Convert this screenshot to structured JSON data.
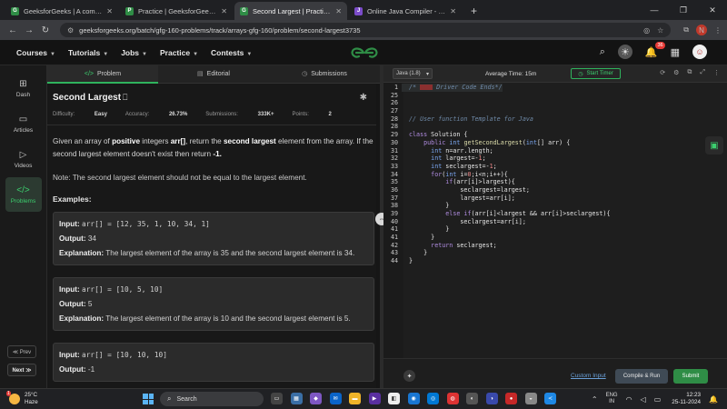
{
  "browser": {
    "tabs": [
      {
        "title": "GeeksforGeeks | A computer sc",
        "fav": "G",
        "color": "#2f8d46",
        "active": false
      },
      {
        "title": "Practice | GeeksforGeeks | A co",
        "fav": "P",
        "color": "#2f8d46",
        "active": false
      },
      {
        "title": "Second Largest | Practice | Gee",
        "fav": "G",
        "color": "#2f8d46",
        "active": true
      },
      {
        "title": "Online Java Compiler - Progra",
        "fav": "J",
        "color": "#7b4cc9",
        "active": false
      }
    ],
    "url": "geeksforgeeks.org/batch/gfg-160-problems/track/arrays-gfg-160/problem/second-largest3735",
    "profile_initial": "N"
  },
  "site": {
    "menu": [
      "Courses",
      "Tutorials",
      "Jobs",
      "Practice",
      "Contests"
    ],
    "logo_color": "#2f8d46",
    "notif_count": "36"
  },
  "rail": {
    "items": [
      {
        "label": "Dash",
        "icon": "⊞"
      },
      {
        "label": "Articles",
        "icon": "▭"
      },
      {
        "label": "Videos",
        "icon": "▷"
      },
      {
        "label": "Problems",
        "icon": "</>"
      }
    ],
    "prev": "≪ Prev",
    "next": "Next ≫"
  },
  "problem_tabs": {
    "problem": "Problem",
    "editorial": "Editorial",
    "submissions": "Submissions"
  },
  "problem": {
    "title": "Second Largest",
    "difficulty_label": "Difficulty:",
    "difficulty": "Easy",
    "accuracy_label": "Accuracy:",
    "accuracy": "26.73%",
    "submissions_label": "Submissions:",
    "submissions": "333K+",
    "points_label": "Points:",
    "points": "2",
    "desc_1": "Given an array of ",
    "desc_b1": "positive",
    "desc_2": " integers ",
    "desc_b2": "arr[]",
    "desc_3": ", return the ",
    "desc_b3": "second largest",
    "desc_4": " element from the array. If the second largest element doesn't exist then return ",
    "desc_b4": "-1.",
    "note": "Note: The second largest element should not be equal to the largest element.",
    "examples_heading": "Examples:",
    "input_label": "Input:",
    "output_label": "Output:",
    "explanation_label": "Explanation:",
    "examples": [
      {
        "input": "arr[] = [12, 35, 1, 10, 34, 1]",
        "output": "34",
        "explanation": "The largest element of the array is 35 and the second largest element is 34."
      },
      {
        "input": "arr[] = [10, 5, 10]",
        "output": "5",
        "explanation": "The largest element of the array is 10 and the second largest element is 5."
      },
      {
        "input": "arr[] = [10, 10, 10]",
        "output": "-1"
      }
    ]
  },
  "editor": {
    "language": "Java (1.8)",
    "avg_time": "Average Time: 15m",
    "start_timer": "Start Timer",
    "custom_input": "Custom Input",
    "compile_run": "Compile & Run",
    "submit": "Submit",
    "lines": [
      {
        "n": "1",
        "t": "/*     Driver Code Ends*/"
      },
      {
        "n": "25",
        "t": ""
      },
      {
        "n": "26",
        "t": ""
      },
      {
        "n": "27",
        "t": ""
      },
      {
        "n": "28",
        "t": "// User function Template for Java"
      },
      {
        "n": "28",
        "t": ""
      },
      {
        "n": "29",
        "t": "class Solution {"
      },
      {
        "n": "30",
        "t": "    public int getSecondLargest(int[] arr) {"
      },
      {
        "n": "31",
        "t": "      int n=arr.length;"
      },
      {
        "n": "32",
        "t": "      int largest=-1;"
      },
      {
        "n": "33",
        "t": "      int seclargest=-1;"
      },
      {
        "n": "34",
        "t": "      for(int i=0;i<n;i++){"
      },
      {
        "n": "35",
        "t": "          if(arr[i]>largest){"
      },
      {
        "n": "36",
        "t": "              seclargest=largest;"
      },
      {
        "n": "37",
        "t": "              largest=arr[i];"
      },
      {
        "n": "38",
        "t": "          }"
      },
      {
        "n": "39",
        "t": "          else if(arr[i]<largest && arr[i]>seclargest){"
      },
      {
        "n": "40",
        "t": "              seclargest=arr[i];"
      },
      {
        "n": "41",
        "t": "          }"
      },
      {
        "n": "41",
        "t": "      }"
      },
      {
        "n": "42",
        "t": "      return seclargest;"
      },
      {
        "n": "43",
        "t": "    }"
      },
      {
        "n": "44",
        "t": "}"
      }
    ]
  },
  "taskbar": {
    "temp": "25°C",
    "weather": "Haze",
    "search": "Search",
    "lang_1": "ENG",
    "lang_2": "IN",
    "time": "12:23",
    "date": "25-11-2024"
  }
}
